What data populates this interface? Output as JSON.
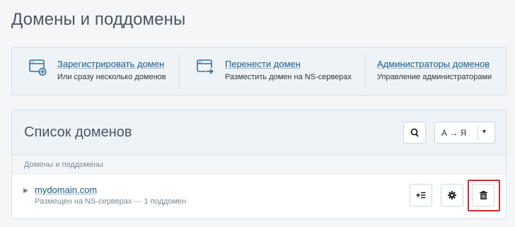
{
  "page": {
    "title": "Домены и поддомены"
  },
  "actions": [
    {
      "label": "Зарегистрировать домен",
      "description": "Или сразу несколько доменов",
      "icon": "register-domain-icon"
    },
    {
      "label": "Перенести домен",
      "description": "Разместить домен на NS-серверах",
      "icon": "transfer-domain-icon"
    },
    {
      "label": "Администраторы доменов",
      "description": "Управление администраторами"
    }
  ],
  "domain_list": {
    "title": "Список доменов",
    "sort": {
      "label": "А → Я",
      "caret": "▾"
    },
    "search_icon": "search-icon",
    "column_header": "Домены и поддомены",
    "rows": [
      {
        "domain": "mydomain.com",
        "hosting": "Размещен на NS-серверах",
        "separator": "—",
        "subdomains": "1 поддомен",
        "actions": [
          "add-subdomain-icon",
          "gear-icon",
          "trash-icon"
        ]
      }
    ]
  },
  "colors": {
    "link": "#1a5a8c",
    "panel_bg": "#eef3f7",
    "highlight": "#d72b2b"
  }
}
